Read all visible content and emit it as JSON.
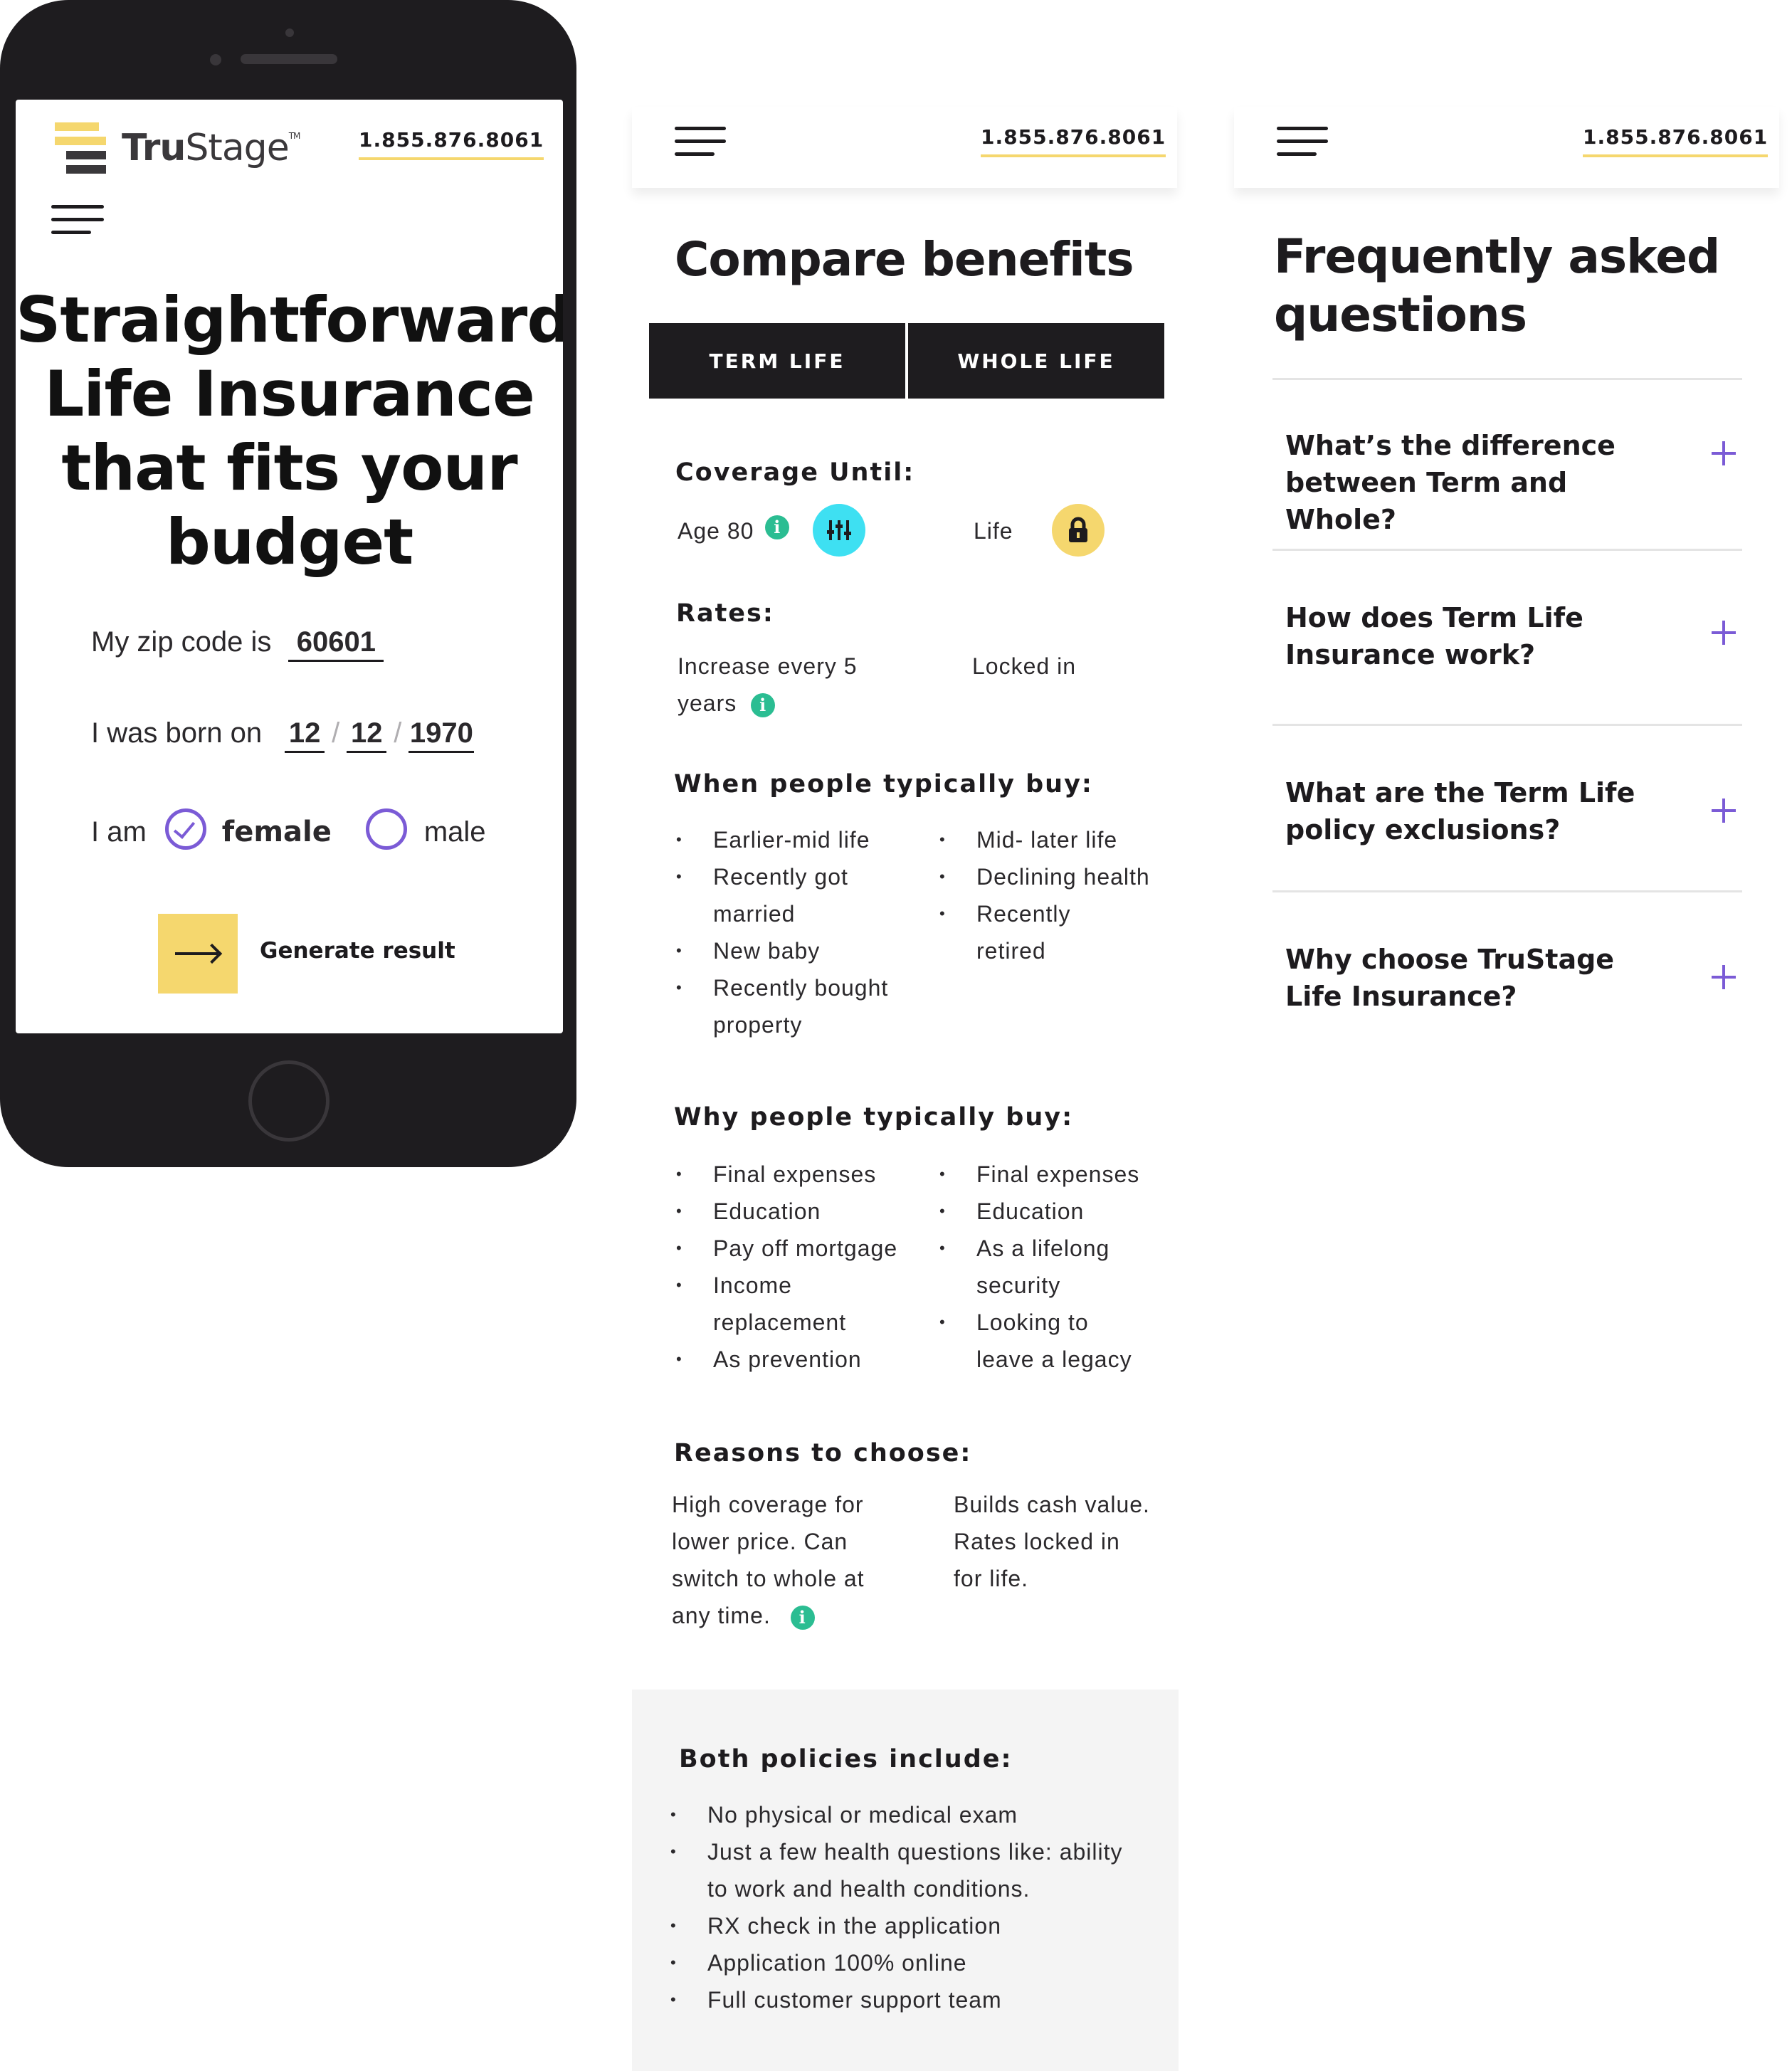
{
  "brand": {
    "name_bold": "Tru",
    "name_regular": "Stage",
    "trademark": "TM",
    "logo_colors": [
      "#f5d76e",
      "#3a383b"
    ]
  },
  "phone_number": "1.855.876.8061",
  "colors": {
    "accent_yellow": "#f5d76e",
    "accent_purple": "#7b5bd6",
    "info_green": "#2bbd92",
    "badge_cyan": "#3ee0f2",
    "dark": "#1e1c1f"
  },
  "hero": {
    "headline_lines": [
      "Straightforward",
      "Life Insurance",
      "that fits your",
      "budget"
    ]
  },
  "form": {
    "zip_label": "My zip code is",
    "zip_value": "60601",
    "born_label": "I was born on",
    "dob_month": "12",
    "dob_day": "12",
    "dob_year": "1970",
    "dob_separator": "/",
    "gender_label": "I am",
    "female_label": "female",
    "male_label": "male",
    "selected_gender": "female",
    "submit_label": "Generate result",
    "submit_icon": "arrow-right-icon"
  },
  "compare": {
    "title": "Compare benefits",
    "tabs": [
      "TERM LIFE",
      "WHOLE LIFE"
    ],
    "coverage": {
      "heading": "Coverage Until:",
      "term": "Age 80",
      "whole": "Life",
      "term_icon": "sliders-icon",
      "whole_icon": "lock-icon"
    },
    "rates": {
      "heading": "Rates:",
      "term_lines": [
        "Increase every 5",
        "years"
      ],
      "whole": "Locked in"
    },
    "when": {
      "heading": "When people typically buy:",
      "term": [
        [
          "Earlier-mid life"
        ],
        [
          "Recently got",
          "married"
        ],
        [
          "New baby"
        ],
        [
          "Recently bought",
          "property"
        ]
      ],
      "whole": [
        [
          "Mid- later life"
        ],
        [
          "Declining health"
        ],
        [
          "Recently",
          "retired"
        ]
      ]
    },
    "why": {
      "heading": "Why people typically buy:",
      "term": [
        [
          "Final expenses"
        ],
        [
          "Education"
        ],
        [
          "Pay off mortgage"
        ],
        [
          "Income",
          "replacement"
        ],
        [
          "As prevention"
        ]
      ],
      "whole": [
        [
          "Final expenses"
        ],
        [
          "Education"
        ],
        [
          "As a lifelong",
          "security"
        ],
        [
          "Looking to",
          "leave a legacy"
        ]
      ]
    },
    "reasons": {
      "heading": "Reasons to choose:",
      "term_lines": [
        "High coverage for",
        "lower price. Can",
        "switch to whole at",
        "any time."
      ],
      "whole_lines": [
        "Builds cash value.",
        "Rates locked in",
        "for life."
      ]
    },
    "both": {
      "heading": "Both policies include:",
      "items": [
        [
          "No physical or medical exam"
        ],
        [
          "Just a few health questions like: ability",
          "to work and health conditions."
        ],
        [
          "RX check in the application"
        ],
        [
          "Application 100% online"
        ],
        [
          "Full customer support team"
        ]
      ]
    },
    "info_glyph": "i"
  },
  "faq": {
    "title_lines": [
      "Frequently asked",
      "questions"
    ],
    "items": [
      [
        "What’s the difference",
        "between Term and Whole?"
      ],
      [
        "How does Term Life",
        "Insurance work?"
      ],
      [
        "What are the Term Life",
        "policy exclusions?"
      ],
      [
        "Why choose TruStage",
        "Life Insurance?"
      ]
    ],
    "expand_icon": "plus-icon"
  }
}
